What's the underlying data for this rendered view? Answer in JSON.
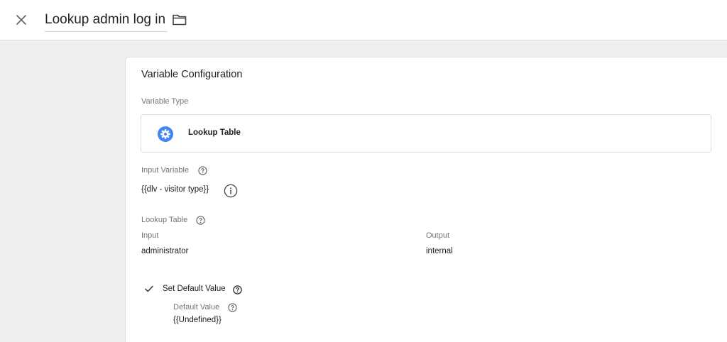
{
  "header": {
    "title": "Lookup admin log in",
    "close_icon": "close-icon",
    "folder_icon": "folder-icon"
  },
  "card": {
    "title": "Variable Configuration",
    "variable_type_label": "Variable Type",
    "variable_type_value": "Lookup Table",
    "variable_type_icon": "gear-icon",
    "input_variable_label": "Input Variable",
    "input_variable_value": "{{dlv - visitor type}}",
    "lookup_table_label": "Lookup Table",
    "table": {
      "headers": [
        "Input",
        "Output"
      ],
      "rows": [
        [
          "administrator",
          "internal"
        ]
      ]
    },
    "set_default_label": "Set Default Value",
    "set_default_checked": true,
    "default_value_label": "Default Value",
    "default_value": "{{Undefined}}"
  },
  "colors": {
    "accent": "#4285f4",
    "background": "#eeeeee",
    "card": "#ffffff"
  }
}
